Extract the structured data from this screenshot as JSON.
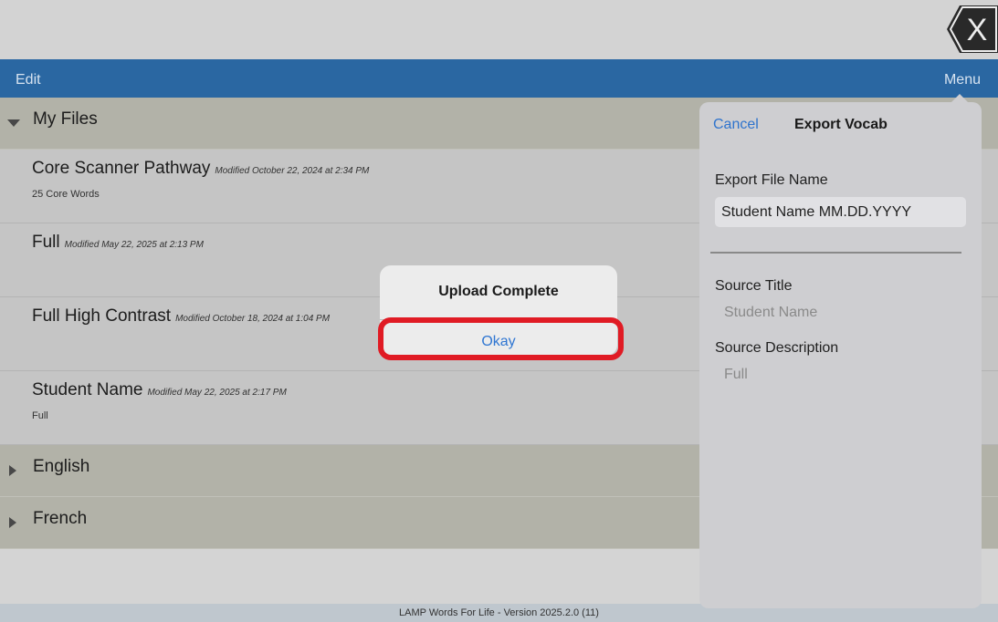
{
  "navbar": {
    "edit_label": "Edit",
    "menu_label": "Menu"
  },
  "close_button": {
    "label": "X"
  },
  "sections": [
    {
      "title": "My Files",
      "expanded": true
    },
    {
      "title": "English",
      "expanded": false
    },
    {
      "title": "French",
      "expanded": false
    }
  ],
  "files": [
    {
      "title": "Core Scanner Pathway",
      "modified": "Modified October 22, 2024 at 2:34 PM",
      "subtitle": "25 Core Words"
    },
    {
      "title": "Full",
      "modified": "Modified May 22, 2025 at 2:13 PM",
      "subtitle": ""
    },
    {
      "title": "Full High Contrast",
      "modified": "Modified October 18, 2024 at 1:04 PM",
      "subtitle": ""
    },
    {
      "title": "Student Name",
      "modified": "Modified May 22, 2025 at 2:17 PM",
      "subtitle": "Full"
    }
  ],
  "popover": {
    "cancel_label": "Cancel",
    "title": "Export Vocab",
    "file_name_label": "Export File Name",
    "file_name_value": "Student Name MM.DD.YYYY",
    "source_title_label": "Source Title",
    "source_title_value": "Student Name",
    "source_description_label": "Source Description",
    "source_description_value": "Full"
  },
  "alert": {
    "title": "Upload Complete",
    "okay_label": "Okay"
  },
  "footer": {
    "version_text": "LAMP Words For Life - Version 2025.2.0 (11)"
  },
  "colors": {
    "navbar": "#2b6aa6",
    "accent_blue": "#2f76d2",
    "highlight_red": "#e01b24"
  }
}
